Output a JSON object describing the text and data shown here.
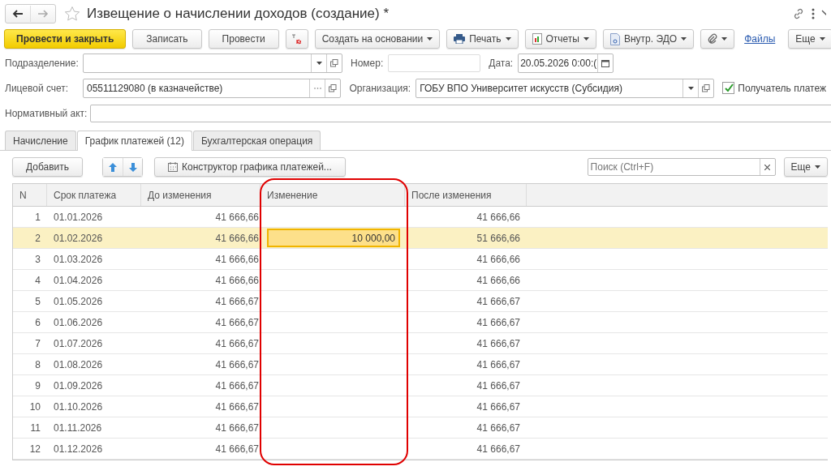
{
  "window": {
    "title": "Извещение о начислении доходов (создание) *",
    "favorite": false
  },
  "toolbar": {
    "buttons": [
      {
        "kind": "primary",
        "label": "Провести и закрыть"
      },
      {
        "kind": "plain",
        "label": "Записать"
      },
      {
        "kind": "plain",
        "label": "Провести"
      },
      {
        "kind": "dtkt"
      },
      {
        "kind": "dropdown",
        "label": "Создать на основании"
      },
      {
        "kind": "print",
        "label": "Печать"
      },
      {
        "kind": "reports",
        "label": "Отчеты"
      },
      {
        "kind": "edo",
        "label": "Внутр. ЭДО"
      },
      {
        "kind": "clip"
      },
      {
        "kind": "link",
        "label": "Файлы"
      },
      {
        "kind": "more",
        "label": "Еще"
      }
    ]
  },
  "fields": {
    "department": {
      "label": "Подразделение:"
    },
    "number": {
      "label": "Номер:"
    },
    "date": {
      "label": "Дата:",
      "value": "20.05.2026  0:00:("
    },
    "account": {
      "label": "Лицевой счет:",
      "value": "05511129080 (в казначействе)"
    },
    "organization": {
      "label": "Организация:",
      "value": "ГОБУ ВПО Университет искусств (Субсидия)"
    },
    "recipient": {
      "label": "Получатель платеж",
      "checked": true
    },
    "act": {
      "label": "Нормативный акт:"
    }
  },
  "tabs": [
    {
      "label": "Начисление",
      "selected": false
    },
    {
      "label": "График платежей (12)",
      "selected": true
    },
    {
      "label": "Бухгалтерская операция",
      "selected": false
    }
  ],
  "table_toolbar": {
    "add": "Добавить",
    "constructor": "Конструктор графика платежей...",
    "search": {
      "placeholder": "Поиск (Ctrl+F)"
    },
    "more": "Еще"
  },
  "table": {
    "columns": [
      "N",
      "Срок платежа",
      "До изменения",
      "Изменение",
      "После изменения"
    ],
    "rows": [
      {
        "n": "1",
        "date": "01.01.2026",
        "before": "41 666,66",
        "change": "",
        "after": "41 666,66",
        "selected": false
      },
      {
        "n": "2",
        "date": "01.02.2026",
        "before": "41 666,66",
        "change": "10 000,00",
        "after": "51 666,66",
        "selected": true
      },
      {
        "n": "3",
        "date": "01.03.2026",
        "before": "41 666,66",
        "change": "",
        "after": "41 666,66",
        "selected": false
      },
      {
        "n": "4",
        "date": "01.04.2026",
        "before": "41 666,66",
        "change": "",
        "after": "41 666,66",
        "selected": false
      },
      {
        "n": "5",
        "date": "01.05.2026",
        "before": "41 666,67",
        "change": "",
        "after": "41 666,67",
        "selected": false
      },
      {
        "n": "6",
        "date": "01.06.2026",
        "before": "41 666,67",
        "change": "",
        "after": "41 666,67",
        "selected": false
      },
      {
        "n": "7",
        "date": "01.07.2026",
        "before": "41 666,67",
        "change": "",
        "after": "41 666,67",
        "selected": false
      },
      {
        "n": "8",
        "date": "01.08.2026",
        "before": "41 666,67",
        "change": "",
        "after": "41 666,67",
        "selected": false
      },
      {
        "n": "9",
        "date": "01.09.2026",
        "before": "41 666,67",
        "change": "",
        "after": "41 666,67",
        "selected": false
      },
      {
        "n": "10",
        "date": "01.10.2026",
        "before": "41 666,67",
        "change": "",
        "after": "41 666,67",
        "selected": false
      },
      {
        "n": "11",
        "date": "01.11.2026",
        "before": "41 666,67",
        "change": "",
        "after": "41 666,67",
        "selected": false
      },
      {
        "n": "12",
        "date": "01.12.2026",
        "before": "41 666,67",
        "change": "",
        "after": "41 666,67",
        "selected": false
      }
    ]
  }
}
